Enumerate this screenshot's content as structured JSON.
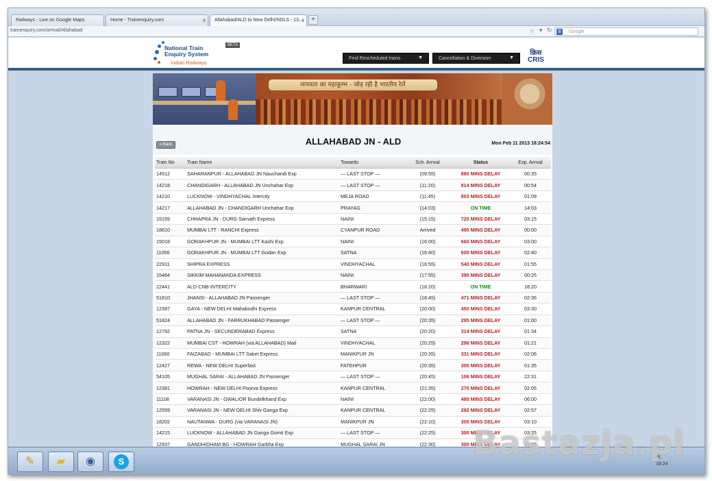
{
  "browser": {
    "tabs": [
      {
        "label": "Railways - Live on Google Maps",
        "active": false
      },
      {
        "label": "Home - Trainenquiry.com",
        "active": false
      },
      {
        "label": "Allahabad/ALD to New Delhi/NDLS - 13...",
        "active": true
      }
    ],
    "new_tab_label": "+",
    "tab_close": "x",
    "url": "trainenquiry.com/arrival/Allahabad",
    "search_placeholder": "Google",
    "search_engine_letter": "8"
  },
  "site": {
    "logo_line1": "National Train",
    "logo_line2": "Enquiry System",
    "logo_line3": "Indian Railways",
    "beta": "BETA",
    "dropdown1": "Find Rescheduled trains",
    "dropdown2": "Cancellation & Diversion",
    "dropdown_arrow": "▼",
    "cris_hindi": "क्रिस",
    "cris_english": "CRIS",
    "banner_slogan": "मानवता का महाकुम्भ - जोड़ रही है भारतीय रेलें"
  },
  "page": {
    "back_label": "« Back",
    "station_title": "ALLAHABAD JN - ALD",
    "datetime": "Mon Feb 11 2013 18:24:54"
  },
  "table": {
    "headers": [
      "Train No",
      "Train Name",
      "Towards",
      "Sch. Arrival",
      "Status",
      "Exp. Arrival"
    ],
    "rows": [
      [
        "14512",
        "SAHARANPUR - ALLAHABAD JN Nauchandi Exp",
        "— LAST STOP —",
        "(09:55)",
        "880 MINS DELAY",
        "00:35",
        "delay"
      ],
      [
        "14218",
        "CHANDIGARH - ALLAHABAD JN Unchahar Exp",
        "— LAST STOP —",
        "(11:20)",
        "814 MINS DELAY",
        "00:54",
        "delay"
      ],
      [
        "14210",
        "LUCKNOW - VINDHYACHAL Intercity",
        "MEJA ROAD",
        "(11:45)",
        "803 MINS DELAY",
        "01:09",
        "delay"
      ],
      [
        "14217",
        "ALLAHABAD JN - CHANDIGARH Unchahar Exp",
        "PRAYAG",
        "(14:03)",
        "ON TIME",
        "14:03",
        "ontime"
      ],
      [
        "15159",
        "CHHAPRA JN - DURG Sarnath Express",
        "NAINI",
        "(15:15)",
        "720 MINS DELAY",
        "03:15",
        "delay"
      ],
      [
        "18610",
        "MUMBAI LTT - RANCHI Express",
        "CYANPUR ROAD",
        "Arrived",
        "490 MINS DELAY",
        "00:00",
        "delay"
      ],
      [
        "15018",
        "GORAKHPUR JN - MUMBAI LTT Kashi Exp",
        "NAINI",
        "(16:00)",
        "660 MINS DELAY",
        "03:00",
        "delay"
      ],
      [
        "11056",
        "GORAKHPUR JN - MUMBAI LTT Godan Exp",
        "SATNA",
        "(16:40)",
        "600 MINS DELAY",
        "02:40",
        "delay"
      ],
      [
        "22911",
        "SHIPRA EXPRESS",
        "VINDHYACHAL",
        "(16:55)",
        "540 MINS DELAY",
        "01:55",
        "delay"
      ],
      [
        "15484",
        "SIKKIM MAHANANDA EXPRESS",
        "NAINI",
        "(17:55)",
        "390 MINS DELAY",
        "00:25",
        "delay"
      ],
      [
        "22441",
        "ALD-CNB-INTERCITY",
        "BHARWARI",
        "(18:20)",
        "ON TIME",
        "18:20",
        "ontime"
      ],
      [
        "51810",
        "JHANSI - ALLAHABAD JN Passenger",
        "— LAST STOP —",
        "(18:45)",
        "471 MINS DELAY",
        "02:36",
        "delay"
      ],
      [
        "12397",
        "GAYA - NEW DELHI Mahabodhi Express",
        "KANPUR CENTRAL",
        "(20:00)",
        "450 MINS DELAY",
        "03:30",
        "delay"
      ],
      [
        "51824",
        "ALLAHABAD JN - FARRUKHABAD Passenger",
        "— LAST STOP —",
        "(20:35)",
        "295 MINS DELAY",
        "01:00",
        "delay"
      ],
      [
        "12792",
        "PATNA JN - SECUNDERABAD Express",
        "SATNA",
        "(20:20)",
        "314 MINS DELAY",
        "01:34",
        "delay"
      ],
      [
        "12322",
        "MUMBAI CST - HOWRAH (via ALLAHABAD) Mail",
        "VINDHYACHAL",
        "(20:25)",
        "296 MINS DELAY",
        "01:21",
        "delay"
      ],
      [
        "11060",
        "FAIZABAD - MUMBAI LTT Saket Express",
        "MANIKPUR JN",
        "(20:35)",
        "331 MINS DELAY",
        "02:06",
        "delay"
      ],
      [
        "12427",
        "REWA - NEW DELHI Superfast",
        "FATEHPUR",
        "(20:35)",
        "300 MINS DELAY",
        "01:35",
        "delay"
      ],
      [
        "54105",
        "MUGHAL SARAI - ALLAHABAD JN Passenger",
        "— LAST STOP —",
        "(20:45)",
        "106 MINS DELAY",
        "22:31",
        "delay"
      ],
      [
        "12381",
        "HOWRAH - NEW DELHI Poorva Express",
        "KANPUR CENTRAL",
        "(21:35)",
        "270 MINS DELAY",
        "02:05",
        "delay"
      ],
      [
        "11108",
        "VARANASI JN - GWALIOR Bundelkhand Exp",
        "NAINI",
        "(22:00)",
        "480 MINS DELAY",
        "06:00",
        "delay"
      ],
      [
        "12559",
        "VARANASI JN - NEW DELHI Shiv Ganga Exp",
        "KANPUR CENTRAL",
        "(22:25)",
        "292 MINS DELAY",
        "02:57",
        "delay"
      ],
      [
        "18202",
        "NAUTANWA - DURG (via VARANASI JN)",
        "MANIKPUR JN",
        "(22:10)",
        "300 MINS DELAY",
        "03:10",
        "delay"
      ],
      [
        "14215",
        "LUCKNOW - ALLAHABAD JN Ganga Gomti Exp",
        "— LAST STOP —",
        "(22:25)",
        "300 MINS DELAY",
        "03:25",
        "delay"
      ],
      [
        "12937",
        "GANDHIDHAM BG - HOWRAH Garbha Exp",
        "MUGHAL SARAI JN",
        "(22:30)",
        "300 MINS DELAY",
        "03:30",
        "delay"
      ]
    ]
  },
  "taskbar": {
    "tray_line1": "PL",
    "tray_line2": "18:24"
  },
  "watermark": "Bastazja.pl",
  "colors": {
    "delay": "#b41f1f",
    "ontime": "#1a8c1a",
    "header_bar": "#3a5e80"
  }
}
